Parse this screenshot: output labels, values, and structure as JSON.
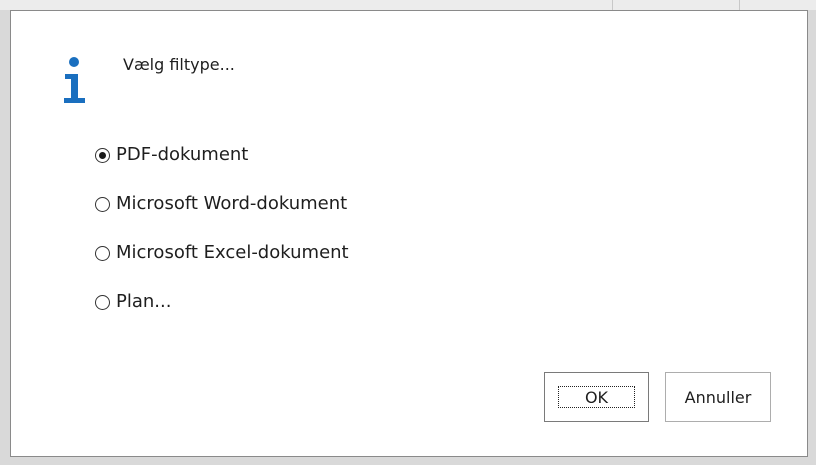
{
  "dialog": {
    "message": "Vælg filtype...",
    "icon": "info-icon",
    "accent_color": "#1a6fbf"
  },
  "options": [
    {
      "label": "PDF-dokument",
      "selected": true
    },
    {
      "label": "Microsoft Word-dokument",
      "selected": false
    },
    {
      "label": "Microsoft Excel-dokument",
      "selected": false
    },
    {
      "label": "Plan...",
      "selected": false
    }
  ],
  "buttons": {
    "ok_label": "OK",
    "cancel_label": "Annuller"
  }
}
